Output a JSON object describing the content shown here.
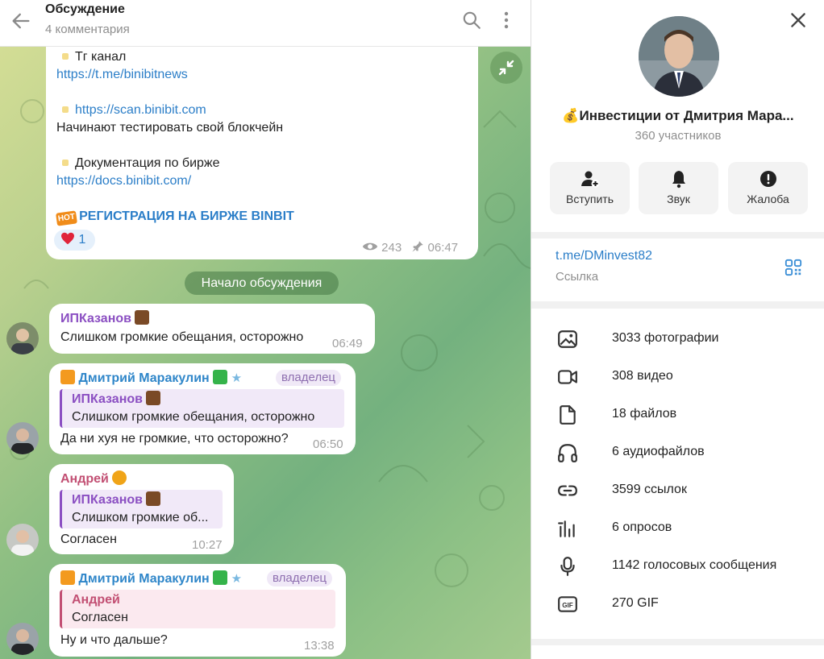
{
  "header": {
    "title": "Обсуждение",
    "subtitle": "4 комментария"
  },
  "post": {
    "line1": "Тг канал",
    "line2": "https://t.me/binibitnews",
    "line3": "https://scan.binibit.com",
    "line4": "Начинают тестировать свой блокчейн",
    "line5": "Документация по бирже",
    "line6": "https://docs.binibit.com/",
    "hot_badge": "HOT",
    "line7": "РЕГИСТРАЦИЯ НА БИРЖЕ BINBIT",
    "reaction_count": "1",
    "views": "243",
    "time": "06:47"
  },
  "divider": "Начало обсуждения",
  "messages": [
    {
      "author": "ИПКазанов",
      "text": "Слишком громкие обещания, осторожно",
      "time": "06:49"
    },
    {
      "author": "Дмитрий Маракулин",
      "badge": "владелец",
      "quote_author": "ИПКазанов",
      "quote_text": "Слишком громкие обещания, осторожно",
      "text": "Да ни хуя не громкие, что осторожно?",
      "time": "06:50"
    },
    {
      "author": "Андрей",
      "quote_author": "ИПКазанов",
      "quote_text": "Слишком громкие об...",
      "text": "Согласен",
      "time": "10:27"
    },
    {
      "author": "Дмитрий Маракулин",
      "badge": "владелец",
      "quote_author": "Андрей",
      "quote_text": "Согласен",
      "text": "Ну и что дальше?",
      "time": "13:38"
    }
  ],
  "channel": {
    "title": "💰Инвестиции от Дмитрия Мара...",
    "members": "360 участников",
    "actions": [
      "Вступить",
      "Звук",
      "Жалоба"
    ],
    "link": "t.me/DMinvest82",
    "link_label": "Ссылка",
    "media": [
      {
        "icon": "photo-icon",
        "label": "3033 фотографии"
      },
      {
        "icon": "video-icon",
        "label": "308 видео"
      },
      {
        "icon": "file-icon",
        "label": "18 файлов"
      },
      {
        "icon": "headphones-icon",
        "label": "6 аудиофайлов"
      },
      {
        "icon": "link-icon",
        "label": "3599 ссылок"
      },
      {
        "icon": "poll-icon",
        "label": "6 опросов"
      },
      {
        "icon": "microphone-icon",
        "label": "1142 голосовых сообщения"
      },
      {
        "icon": "gif-icon",
        "label": "270 GIF"
      }
    ]
  },
  "colors": {
    "link": "#2b7ec8",
    "name_purple": "#8b4fc2",
    "name_blue": "#2f86c9",
    "name_pink": "#c24f73"
  }
}
